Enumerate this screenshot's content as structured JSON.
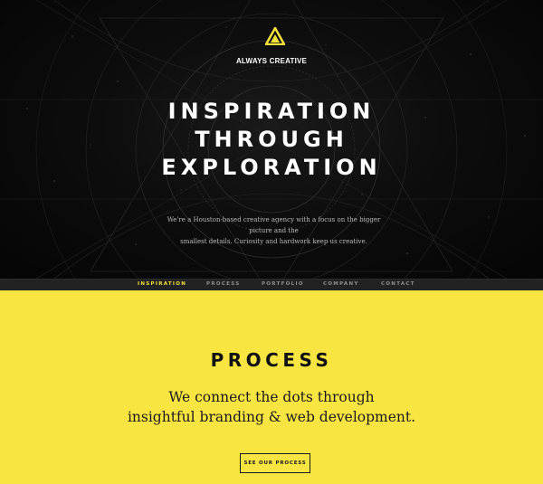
{
  "header": {
    "logo_icon": "triangle-logo-icon",
    "brand": "ALWAYS CREATIVE",
    "headline": [
      "INSPIRATION",
      "THROUGH",
      "EXPLORATION"
    ],
    "intro": [
      "We're a Houston-based creative agency with a focus on the bigger picture and the",
      "smallest details. Curiosity and hardwork keep us creative."
    ]
  },
  "nav": {
    "items": [
      {
        "label": "INSPIRATION",
        "active": true
      },
      {
        "label": "PROCESS",
        "active": false
      },
      {
        "label": "PORTFOLIO",
        "active": false
      },
      {
        "label": "COMPANY",
        "active": false
      },
      {
        "label": "CONTACT",
        "active": false
      }
    ]
  },
  "process": {
    "title": "PROCESS",
    "text": [
      "We connect the dots through",
      "insightful branding & web development."
    ],
    "button_label": "SEE OUR PROCESS"
  },
  "colors": {
    "accent": "#f9e542",
    "hero_bg": "#0b0b0b",
    "nav_bg": "#222222",
    "nav_active": "#f5e23c"
  }
}
